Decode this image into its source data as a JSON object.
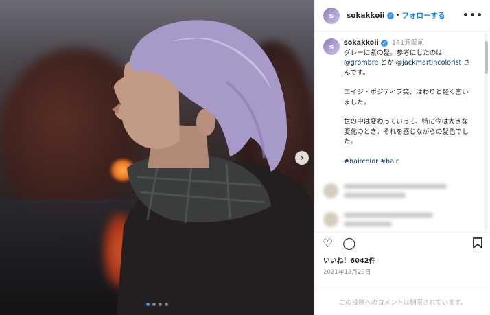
{
  "post": {
    "username": "sokakkoii",
    "follow_separator": "•",
    "follow_label": "フォローする",
    "more_label": "•••",
    "avatar_initial": "s"
  },
  "caption": {
    "username": "sokakkoii",
    "timestamp": "141週間前",
    "line1": "グレーに紫の髪。参考にしたのは",
    "mention1": "@grombre",
    "between": " とか ",
    "mention2": "@jackmartincolorist",
    "line1_end": " さんです。",
    "para2": "エイジ・ポジティブ笑、はわりと軽く言いました。",
    "para3": "世の中は変わっていって、特に今は大きな変化のとき。それを感じながらの髪色でした。",
    "hashtags": "#haircolor #hair"
  },
  "carousel": {
    "next_label": "›",
    "total_slides": 4,
    "active_slide": 1
  },
  "engagement": {
    "likes_text": "いいね！6042件",
    "date_text": "2021年12月29日"
  },
  "footer": {
    "comments_closed": "この投稿へのコメントは制限されています。"
  },
  "icons": {
    "heart": "heart-icon",
    "comment": "comment-icon",
    "save": "bookmark-icon",
    "verified": "verified-badge-icon"
  },
  "colors": {
    "accent": "#0095f6",
    "verified": "#3897f0",
    "active_dot": "#3d9df2",
    "link": "#00376b"
  }
}
